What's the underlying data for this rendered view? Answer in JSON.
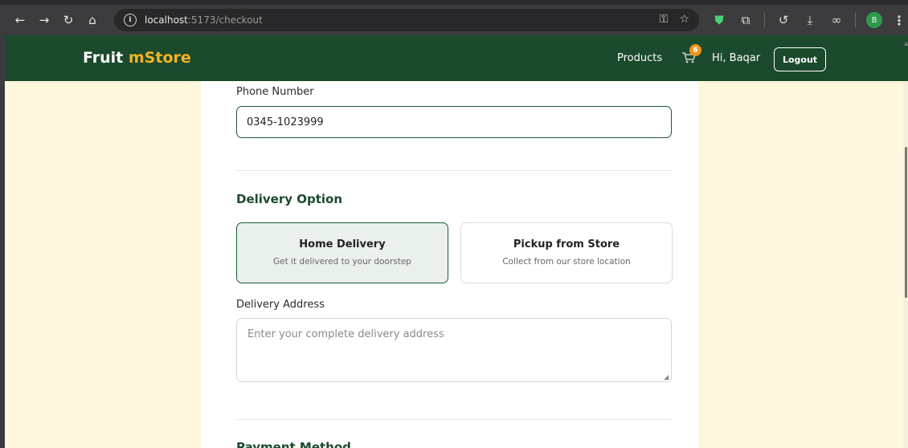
{
  "browser": {
    "url_host": "localhost",
    "url_rest": ":5173/checkout",
    "profile_initial": "B"
  },
  "header": {
    "brand_part1": "Fruit ",
    "brand_part2": "mStore",
    "products_label": "Products",
    "cart_count": "6",
    "greeting": "Hi, Baqar",
    "logout_label": "Logout"
  },
  "form": {
    "phone_label": "Phone Number",
    "phone_value": "0345-1023999",
    "delivery_section_title": "Delivery Option",
    "options": [
      {
        "title": "Home Delivery",
        "subtitle": "Get it delivered to your doorstep",
        "selected": true
      },
      {
        "title": "Pickup from Store",
        "subtitle": "Collect from our store location",
        "selected": false
      }
    ],
    "address_label": "Delivery Address",
    "address_placeholder": "Enter your complete delivery address",
    "payment_section_title": "Payment Method"
  },
  "colors": {
    "header_bg": "#1c4a2c",
    "brand_accent": "#f5b323",
    "page_bg": "#fdf8dd",
    "badge": "#f0951c"
  }
}
